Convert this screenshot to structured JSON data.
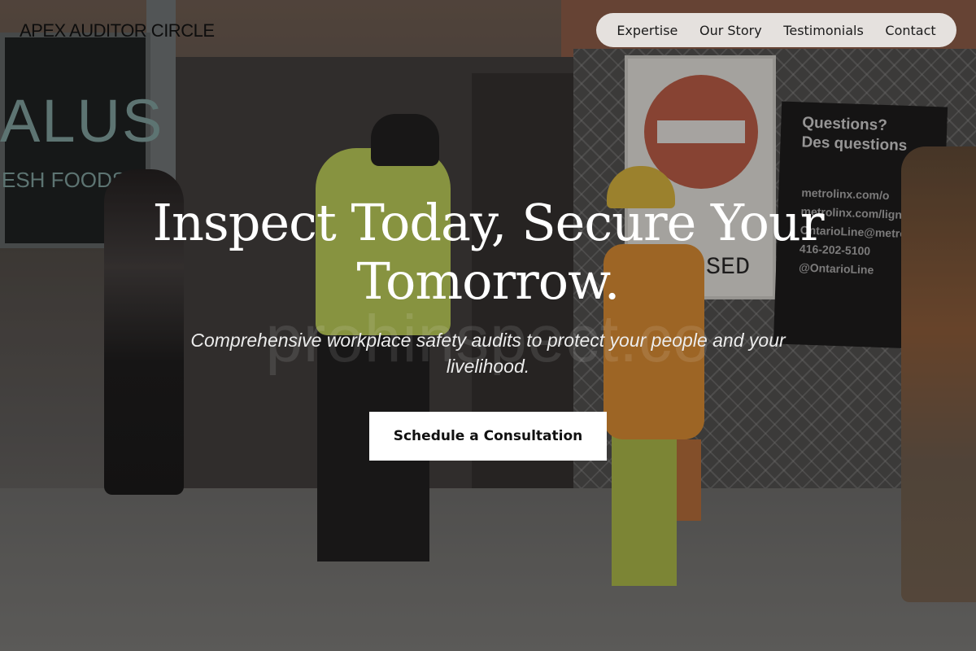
{
  "brand": {
    "name": "APEX AUDITOR CIRCLE"
  },
  "nav": {
    "items": [
      {
        "label": "Expertise"
      },
      {
        "label": "Our Story"
      },
      {
        "label": "Testimonials"
      },
      {
        "label": "Contact"
      }
    ]
  },
  "hero": {
    "title": "Inspect Today, Secure Your Tomorrow.",
    "subtitle": "Comprehensive workplace safety audits to protect your people and your livelihood.",
    "watermark": "prohinspect.co",
    "cta_label": "Schedule a Consultation"
  },
  "background": {
    "store_sign": "ALUS",
    "store_sub": "ESH FOODS",
    "road_sign_text": "SED",
    "board_title": "Questions?\nDes questions",
    "board_lines": "metrolinx.com/o\nmetrolinx.com/ligne\nOntarioLine@metrolinx\n416-202-5100\n@OntarioLine"
  },
  "colors": {
    "text_light": "#ffffff",
    "nav_bg": "#ecece8",
    "cta_bg": "#ffffff",
    "cta_text": "#111111"
  }
}
